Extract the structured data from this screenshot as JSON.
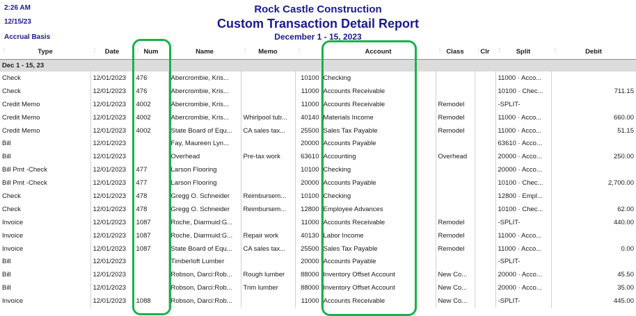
{
  "header": {
    "time": "2:26 AM",
    "date": "12/15/23",
    "basis": "Accrual Basis",
    "company": "Rock Castle Construction",
    "report_title": "Custom Transaction Detail Report",
    "date_range": "December 1 - 15, 2023"
  },
  "columns": [
    "Type",
    "Date",
    "Num",
    "Name",
    "Memo",
    "",
    "Account",
    "Class",
    "Clr",
    "Split",
    "Debit"
  ],
  "group_label": "Dec 1 - 15, 23",
  "rows": [
    {
      "type": "Check",
      "date": "12/01/2023",
      "num": "476",
      "name": "Abercrombie, Kris...",
      "memo": "",
      "acct_no": "10100",
      "account": "Checking",
      "class": "",
      "clr": "",
      "split": "11000 · Acco...",
      "debit": ""
    },
    {
      "type": "Check",
      "date": "12/01/2023",
      "num": "476",
      "name": "Abercrombie, Kris...",
      "memo": "",
      "acct_no": "11000",
      "account": "Accounts Receivable",
      "class": "",
      "clr": "",
      "split": "10100 · Chec...",
      "debit": "711.15"
    },
    {
      "type": "Credit Memo",
      "date": "12/01/2023",
      "num": "4002",
      "name": "Abercrombie, Kris...",
      "memo": "",
      "acct_no": "11000",
      "account": "Accounts Receivable",
      "class": "Remodel",
      "clr": "",
      "split": "-SPLIT-",
      "debit": ""
    },
    {
      "type": "Credit Memo",
      "date": "12/01/2023",
      "num": "4002",
      "name": "Abercrombie, Kris...",
      "memo": "Whirlpool tub...",
      "acct_no": "40140",
      "account": "Materials Income",
      "class": "Remodel",
      "clr": "",
      "split": "11000 · Acco...",
      "debit": "660.00"
    },
    {
      "type": "Credit Memo",
      "date": "12/01/2023",
      "num": "4002",
      "name": "State Board of Equ...",
      "memo": "CA sales tax...",
      "acct_no": "25500",
      "account": "Sales Tax Payable",
      "class": "Remodel",
      "clr": "",
      "split": "11000 · Acco...",
      "debit": "51.15"
    },
    {
      "type": "Bill",
      "date": "12/01/2023",
      "num": "",
      "name": "Fay, Maureen Lyn...",
      "memo": "",
      "acct_no": "20000",
      "account": "Accounts Payable",
      "class": "",
      "clr": "",
      "split": "63610 · Acco...",
      "debit": ""
    },
    {
      "type": "Bill",
      "date": "12/01/2023",
      "num": "",
      "name": "Overhead",
      "memo": "Pre-tax work",
      "acct_no": "63610",
      "account": "Accounting",
      "class": "Overhead",
      "clr": "",
      "split": "20000 · Acco...",
      "debit": "250.00"
    },
    {
      "type": "Bill Pmt -Check",
      "date": "12/01/2023",
      "num": "477",
      "name": "Larson Flooring",
      "memo": "",
      "acct_no": "10100",
      "account": "Checking",
      "class": "",
      "clr": "",
      "split": "20000 · Acco...",
      "debit": ""
    },
    {
      "type": "Bill Pmt -Check",
      "date": "12/01/2023",
      "num": "477",
      "name": "Larson Flooring",
      "memo": "",
      "acct_no": "20000",
      "account": "Accounts Payable",
      "class": "",
      "clr": "",
      "split": "10100 · Chec...",
      "debit": "2,700.00"
    },
    {
      "type": "Check",
      "date": "12/01/2023",
      "num": "478",
      "name": "Gregg O. Schneider",
      "memo": "Reimbursem...",
      "acct_no": "10100",
      "account": "Checking",
      "class": "",
      "clr": "",
      "split": "12800 · Empl...",
      "debit": ""
    },
    {
      "type": "Check",
      "date": "12/01/2023",
      "num": "478",
      "name": "Gregg O. Schneider",
      "memo": "Reimbursem...",
      "acct_no": "12800",
      "account": "Employee Advances",
      "class": "",
      "clr": "",
      "split": "10100 · Chec...",
      "debit": "62.00"
    },
    {
      "type": "Invoice",
      "date": "12/01/2023",
      "num": "1087",
      "name": "Roche, Diarmuid:G...",
      "memo": "",
      "acct_no": "11000",
      "account": "Accounts Receivable",
      "class": "Remodel",
      "clr": "",
      "split": "-SPLIT-",
      "debit": "440.00"
    },
    {
      "type": "Invoice",
      "date": "12/01/2023",
      "num": "1087",
      "name": "Roche, Diarmuid:G...",
      "memo": "Repair work",
      "acct_no": "40130",
      "account": "Labor Income",
      "class": "Remodel",
      "clr": "",
      "split": "11000 · Acco...",
      "debit": ""
    },
    {
      "type": "Invoice",
      "date": "12/01/2023",
      "num": "1087",
      "name": "State Board of Equ...",
      "memo": "CA sales tax...",
      "acct_no": "25500",
      "account": "Sales Tax Payable",
      "class": "Remodel",
      "clr": "",
      "split": "11000 · Acco...",
      "debit": "0.00"
    },
    {
      "type": "Bill",
      "date": "12/01/2023",
      "num": "",
      "name": "Timberloft Lumber",
      "memo": "",
      "acct_no": "20000",
      "account": "Accounts Payable",
      "class": "",
      "clr": "",
      "split": "-SPLIT-",
      "debit": ""
    },
    {
      "type": "Bill",
      "date": "12/01/2023",
      "num": "",
      "name": "Robson, Darci:Rob...",
      "memo": "Rough lumber",
      "acct_no": "88000",
      "account": "Inventory Offset Account",
      "class": "New Co...",
      "clr": "",
      "split": "20000 · Acco...",
      "debit": "45.50"
    },
    {
      "type": "Bill",
      "date": "12/01/2023",
      "num": "",
      "name": "Robson, Darci:Rob...",
      "memo": "Trim lumber",
      "acct_no": "88000",
      "account": "Inventory Offset Account",
      "class": "New Co...",
      "clr": "",
      "split": "20000 · Acco...",
      "debit": "35.00"
    },
    {
      "type": "Invoice",
      "date": "12/01/2023",
      "num": "1088",
      "name": "Robson, Darci:Rob...",
      "memo": "",
      "acct_no": "11000",
      "account": "Accounts Receivable",
      "class": "New Co...",
      "clr": "",
      "split": "-SPLIT-",
      "debit": "445.00"
    }
  ],
  "colors": {
    "title": "#1a1a8c",
    "highlight": "#18b24a",
    "group_bg": "#dcdcdc"
  }
}
